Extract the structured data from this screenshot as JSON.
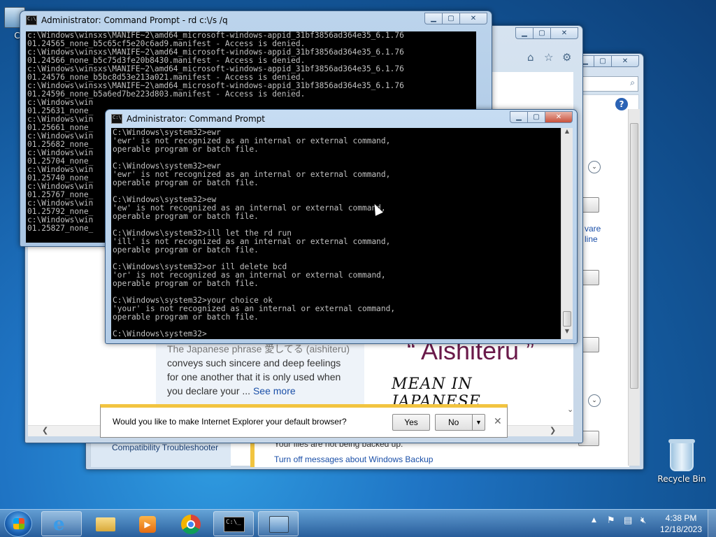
{
  "desktop": {
    "computer_label": "Co",
    "recycle_bin_label": "Recycle Bin"
  },
  "cmd_back": {
    "title": "Administrator:  Command Prompt - rd  c:\\/s /q",
    "lines": [
      "c:\\Windows\\winsxs\\MANIFE~2\\amd64_microsoft-windows-appid_31bf3856ad364e35_6.1.76",
      "01.24565_none_b5c65cf5e20c6ad9.manifest - Access is denied.",
      "c:\\Windows\\winsxs\\MANIFE~2\\amd64_microsoft-windows-appid_31bf3856ad364e35_6.1.76",
      "01.24566_none_b5c75d3fe20b8430.manifest - Access is denied.",
      "c:\\Windows\\winsxs\\MANIFE~2\\amd64_microsoft-windows-appid_31bf3856ad364e35_6.1.76",
      "01.24576_none_b5bc8d53e213a021.manifest - Access is denied.",
      "c:\\Windows\\winsxs\\MANIFE~2\\amd64_microsoft-windows-appid_31bf3856ad364e35_6.1.76",
      "01.24596_none_b5a6ed7be223d803.manifest - Access is denied.",
      "c:\\Windows\\win",
      "01.25631_none_",
      "c:\\Windows\\win",
      "01.25661_none_",
      "c:\\Windows\\win",
      "01.25682_none_",
      "c:\\Windows\\win",
      "01.25704_none_",
      "c:\\Windows\\win",
      "01.25740_none_",
      "c:\\Windows\\win",
      "01.25767_none_",
      "c:\\Windows\\win",
      "01.25792_none_",
      "c:\\Windows\\win",
      "01.25827_none_"
    ]
  },
  "cmd_front": {
    "title": "Administrator:  Command Prompt",
    "lines": [
      "C:\\Windows\\system32>ewr",
      "'ewr' is not recognized as an internal or external command,",
      "operable program or batch file.",
      "",
      "C:\\Windows\\system32>ewr",
      "'ewr' is not recognized as an internal or external command,",
      "operable program or batch file.",
      "",
      "C:\\Windows\\system32>ew",
      "'ew' is not recognized as an internal or external command,",
      "operable program or batch file.",
      "",
      "C:\\Windows\\system32>ill let the rd run",
      "'ill' is not recognized as an internal or external command,",
      "operable program or batch file.",
      "",
      "C:\\Windows\\system32>or ill delete bcd",
      "'or' is not recognized as an internal or external command,",
      "operable program or batch file.",
      "",
      "C:\\Windows\\system32>your choice ok",
      "'your' is not recognized as an internal or external command,",
      "operable program or batch file.",
      "",
      "C:\\Windows\\system32>"
    ]
  },
  "ie": {
    "article_lines": [
      "The Japanese phrase 愛してる (aishiteru)",
      "conveys such sincere and deep feelings",
      "for one another that it is only used when",
      "you declare your ..."
    ],
    "see_more": "See more",
    "image_title": "“ Aishiteru ”",
    "image_subtitle": "MEAN IN JAPANESE",
    "notify_text": "Would you like to make Internet Explorer your default browser?",
    "yes": "Yes",
    "no": "No"
  },
  "action_center": {
    "link_ware": "vare",
    "link_line": "line",
    "compat": "Compatibility Troubleshooter",
    "backup_msg": "Your files are not being backed up.",
    "backup_link": "Turn off messages about Windows Backup"
  },
  "clock": {
    "time": "4:38 PM",
    "date": "12/18/2023"
  },
  "colors": {
    "accent": "#1f74c4",
    "link": "#1a4fa8",
    "notify_bar": "#f2c440"
  }
}
